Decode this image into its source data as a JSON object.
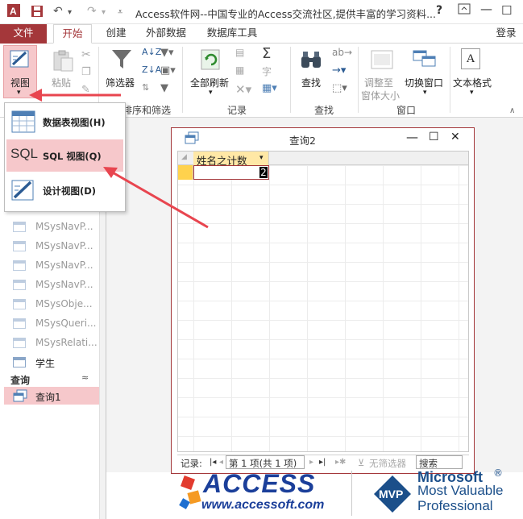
{
  "window": {
    "title": "Access软件网--中国专业的Access交流社区,提供丰富的学习资料...",
    "help": "?",
    "minimize": "—",
    "maximize": "☐",
    "close": "✕"
  },
  "quick_access": [
    "save-icon",
    "undo-icon",
    "redo-icon"
  ],
  "tabs": [
    "文件",
    "开始",
    "创建",
    "外部数据",
    "数据库工具"
  ],
  "login": "登录",
  "ribbon": {
    "view_label": "视图",
    "paste_label": "粘贴",
    "filter_label": "筛选器",
    "refresh_label": "全部刷新",
    "find_label": "查找",
    "resize_label_1": "调整至",
    "resize_label_2": "窗体大小",
    "switch_window_label": "切换窗口",
    "text_format_label": "文本格式",
    "text_format_glyph": "A",
    "groups": {
      "sort_filter": "排序和筛选",
      "records": "记录",
      "find": "查找",
      "window": "窗口"
    }
  },
  "view_menu": {
    "datasheet": "数据表视图(H)",
    "sql": "SQL 视图(Q)",
    "sql_glyph": "SQL",
    "design": "设计视图(D)"
  },
  "nav_pane": {
    "tables": [
      "MSysNavP...",
      "MSysNavP...",
      "MSysNavP...",
      "MSysNavP...",
      "MSysObje...",
      "MSysQueri...",
      "MSysRelati..."
    ],
    "student_table": "学生",
    "section_query": "查询",
    "section_chevron": "≈",
    "query_item": "查询1"
  },
  "query_window": {
    "title": "查询2",
    "column_header": "姓名之计数",
    "cell_value": "2",
    "nav": {
      "records_label": "记录:",
      "record_position": "第 1 项(共 1 项)",
      "no_filter": "无筛选器",
      "search": "搜索"
    }
  },
  "logos": {
    "access_text": "ACCESS",
    "access_url": "www.accessoft.com",
    "mvp_badge": "MVP",
    "ms_text": "Microsoft",
    "ms_reg": "®",
    "mvp_line1": "Most Valuable",
    "mvp_line2": "Professional"
  },
  "colors": {
    "accent": "#a4373a",
    "highlight": "#f6c8cb",
    "arrow": "#e8454f"
  }
}
